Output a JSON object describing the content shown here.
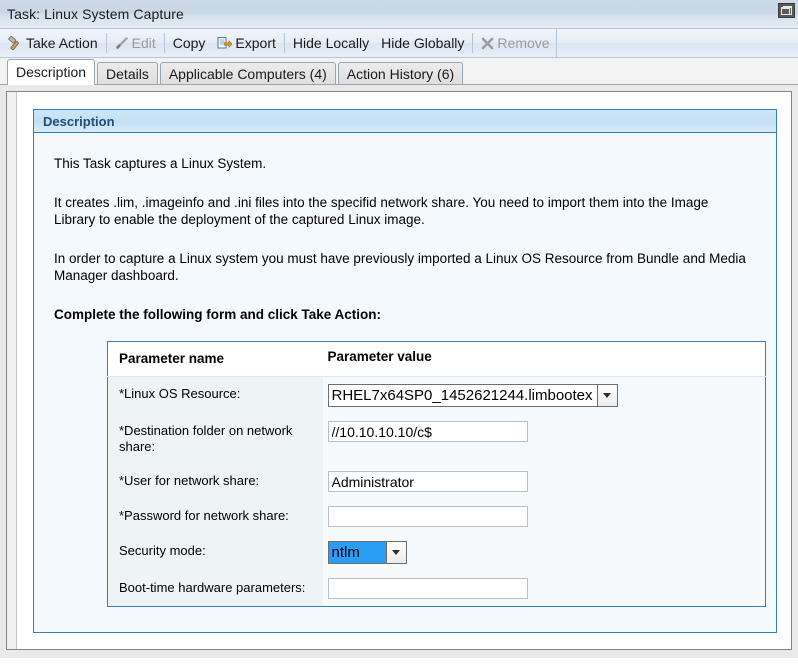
{
  "window": {
    "title": "Task: Linux System Capture",
    "restore_button_name": "restore"
  },
  "toolbar": {
    "items": [
      {
        "label": "Take Action",
        "icon": "hammer-icon",
        "disabled": false
      },
      {
        "label": "Edit",
        "icon": "pencil-icon",
        "disabled": true
      },
      {
        "label": "Copy",
        "icon": "",
        "disabled": false
      },
      {
        "label": "Export",
        "icon": "export-icon",
        "disabled": false
      },
      {
        "label": "Hide Locally",
        "icon": "",
        "disabled": false
      },
      {
        "label": "Hide Globally",
        "icon": "",
        "disabled": false
      },
      {
        "label": "Remove",
        "icon": "x-icon",
        "disabled": true
      }
    ]
  },
  "tabs": [
    {
      "label": "Description",
      "active": true
    },
    {
      "label": "Details",
      "active": false
    },
    {
      "label": "Applicable Computers (4)",
      "active": false
    },
    {
      "label": "Action History (6)",
      "active": false
    }
  ],
  "panel": {
    "header": "Description",
    "paragraphs": [
      "This Task captures a Linux System.",
      "It creates .lim, .imageinfo and .ini files into the specifid network share. You need to import them into the Image Library to enable the deployment of the captured Linux image.",
      "In order to capture a Linux system you must have previously imported a Linux OS Resource from Bundle and Media Manager dashboard."
    ],
    "instruction": "Complete the following form and click Take Action:"
  },
  "form": {
    "columns": [
      "Parameter name",
      "Parameter value"
    ],
    "rows": [
      {
        "name": "*Linux OS Resource:",
        "control": "select",
        "value": "RHEL7x64SP0_1452621244.limbootex",
        "placeholder": "",
        "highlighted": false
      },
      {
        "name": "*Destination folder on network share:",
        "control": "text",
        "value": "//10.10.10.10/c$",
        "placeholder": "",
        "highlighted": false
      },
      {
        "name": "*User for network share:",
        "control": "text",
        "value": "Administrator",
        "placeholder": "",
        "highlighted": false
      },
      {
        "name": "*Password for network share:",
        "control": "text",
        "value": "",
        "placeholder": "",
        "highlighted": false
      },
      {
        "name": "Security mode:",
        "control": "select",
        "value": "ntlm",
        "placeholder": "",
        "highlighted": true
      },
      {
        "name": "Boot-time hardware parameters:",
        "control": "text",
        "value": "",
        "placeholder": "",
        "highlighted": false
      }
    ]
  },
  "colors": {
    "panel_border": "#2f7fc1",
    "panel_header_text": "#1f4e79",
    "selection_highlight": "#2a9df4",
    "titlebar": "#ccd9e8"
  }
}
